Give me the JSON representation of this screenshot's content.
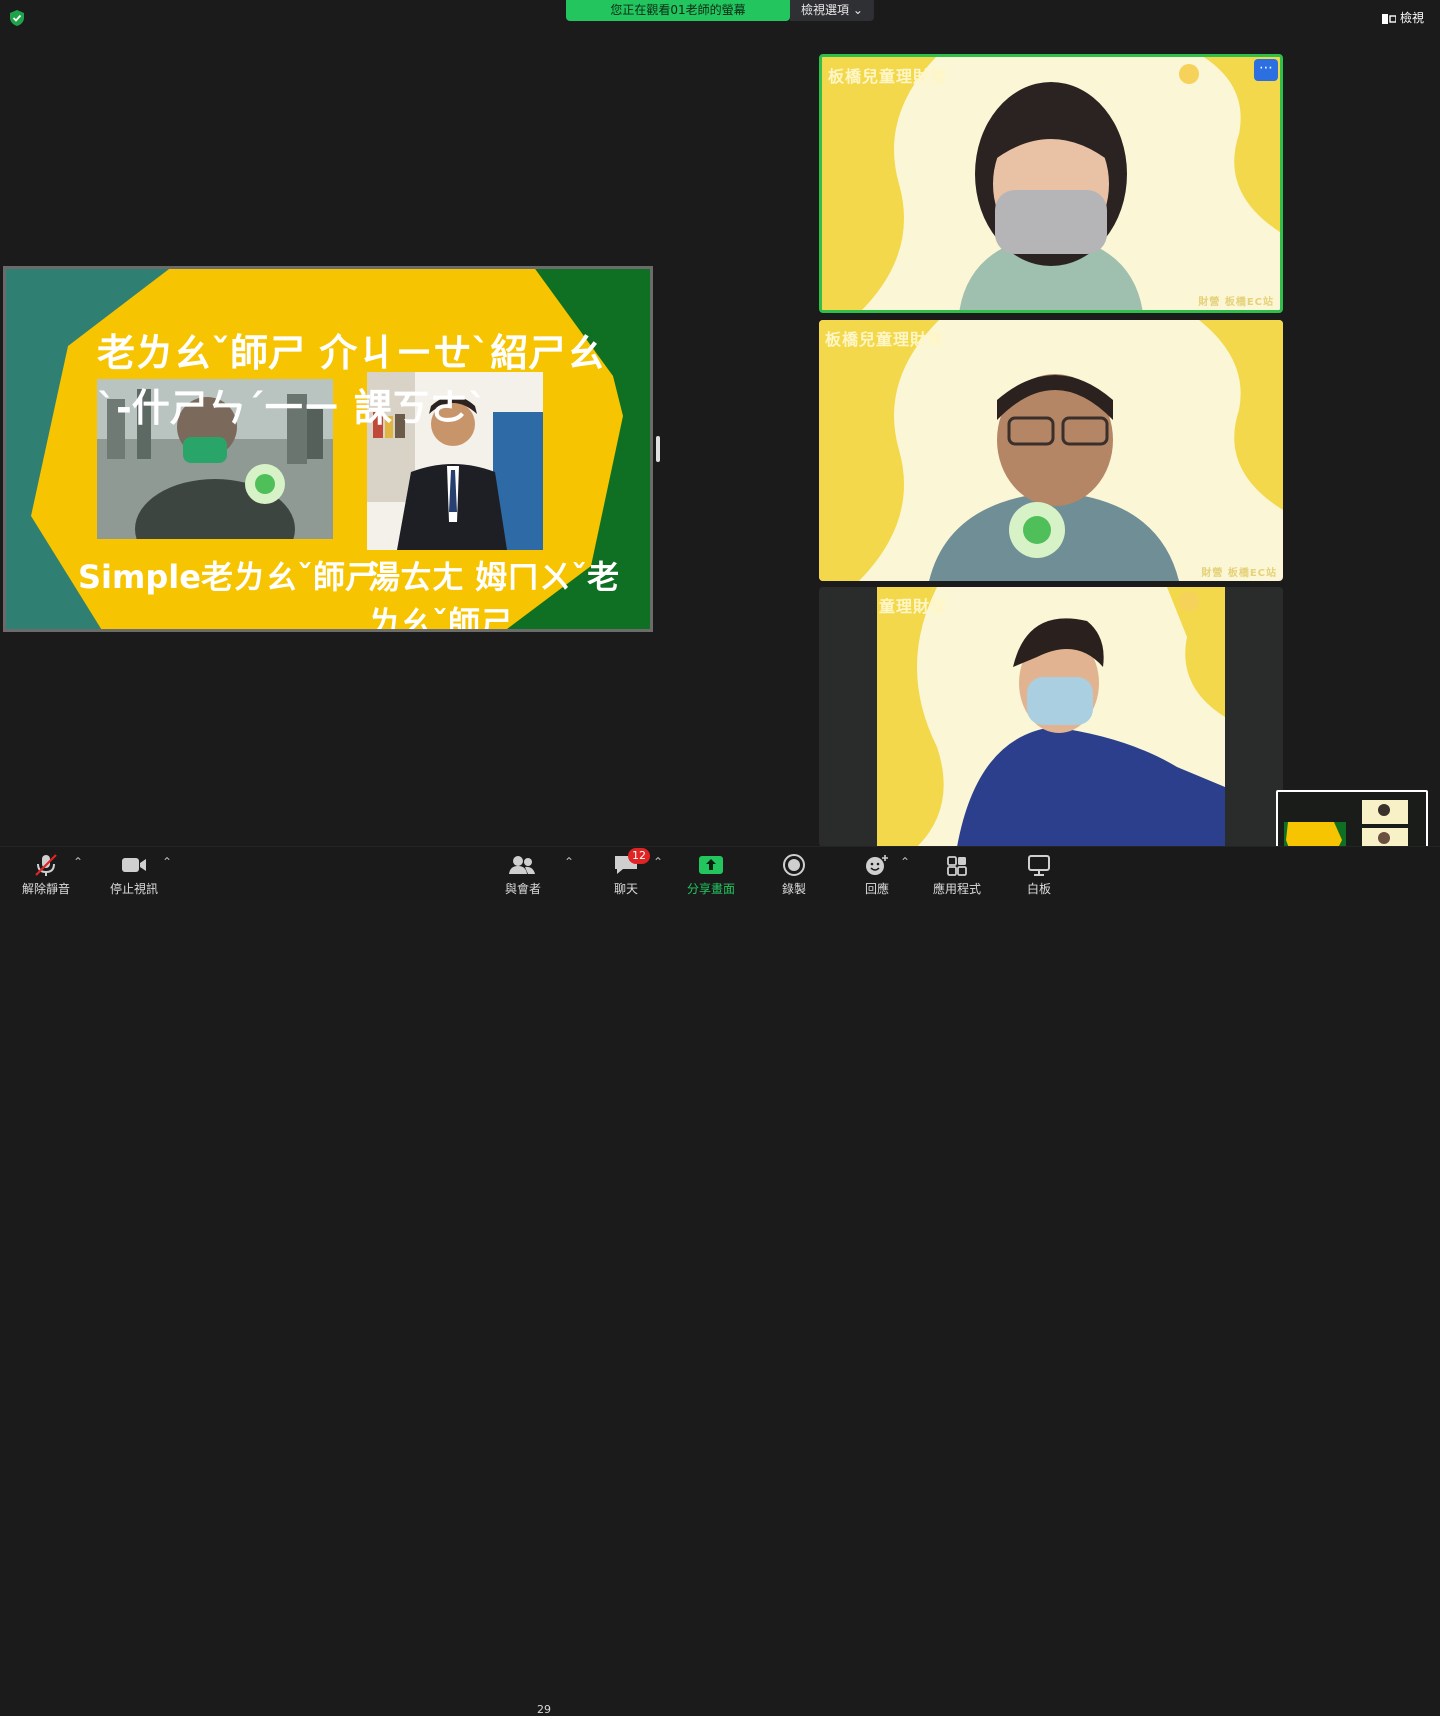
{
  "top": {
    "banner": "您正在觀看01老師的螢幕",
    "view_options": "檢視選項",
    "view_button": "檢視"
  },
  "slide": {
    "title": "老ㄌㄠˇ師ㄕ 介ㄐㄧㄝˋ紹ㄕㄠˋ-什ㄕㄣˊ一ㄧ 課ㄎㄜˋ",
    "caption_left": "Simple老ㄌㄠˇ師ㄕ",
    "caption_right": "湯ㄊㄤ 姆ㄇㄨˇ老ㄌㄠˇ師ㄕ"
  },
  "tiles": [
    {
      "label": "板橋兒童理財營",
      "footer": "財營 板橋EC站"
    },
    {
      "label": "板橋兒童理財營",
      "footer": "財營 板橋EC站"
    },
    {
      "label": "童理財營"
    }
  ],
  "toolbar": {
    "unmute": "解除靜音",
    "stop_video": "停止視訊",
    "participants": "與會者",
    "participants_count": "29",
    "chat": "聊天",
    "chat_badge": "12",
    "share_screen": "分享畫面",
    "record": "錄製",
    "reactions": "回應",
    "apps": "應用程式",
    "whiteboard": "白板"
  },
  "colors": {
    "banner_green": "#22c55e",
    "slide_yellow": "#f6c400",
    "slide_green": "#0f6f22",
    "slide_teal": "#2f7f73",
    "tile_yellow": "#f2d84a",
    "active_border": "#2fbf4a",
    "share_green": "#22c55e",
    "badge_red": "#e02424"
  }
}
